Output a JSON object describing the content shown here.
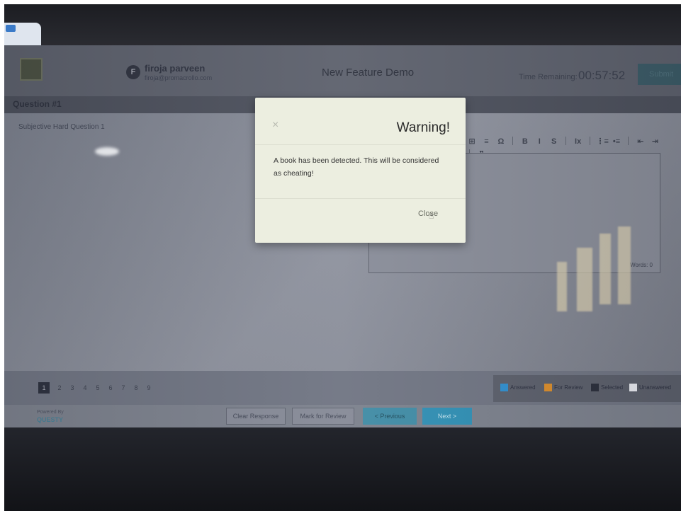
{
  "header": {
    "user_initial": "F",
    "user_name": "firoja parveen",
    "user_email": "firoja@promacrollo.com",
    "test_title": "New Feature Demo",
    "time_label": "Time Remaining:",
    "time_value": "00:57:52",
    "submit_label": "Submit"
  },
  "question": {
    "number_label": "Question #1",
    "text": "Subjective Hard Question 1"
  },
  "editor": {
    "toolbar": [
      "⊞",
      "≡",
      "Ω",
      "B",
      "I",
      "S",
      "Ix",
      "⋮≡",
      "•≡",
      "⇤",
      "⇥",
      "❞"
    ],
    "word_count": "Words: 0"
  },
  "pagination": {
    "pages": [
      "1",
      "2",
      "3",
      "4",
      "5",
      "6",
      "7",
      "8",
      "9"
    ],
    "active": "1"
  },
  "legend": {
    "items": [
      {
        "label": "Answered",
        "color": "#2f8fcf"
      },
      {
        "label": "For Review",
        "color": "#d98c2b"
      },
      {
        "label": "Selected",
        "color": "#2b2f3c"
      },
      {
        "label": "Unanswered",
        "color": "#e6e8ee"
      }
    ]
  },
  "footer": {
    "powered_by": "Powered By",
    "brand": "QUESTY",
    "clear_label": "Clear Response",
    "review_label": "Mark for Review",
    "previous_label": "< Previous",
    "next_label": "Next >"
  },
  "modal": {
    "close_icon": "×",
    "title": "Warning!",
    "message": "A book has been detected. This will be considered as cheating!",
    "close_label": "Close"
  }
}
